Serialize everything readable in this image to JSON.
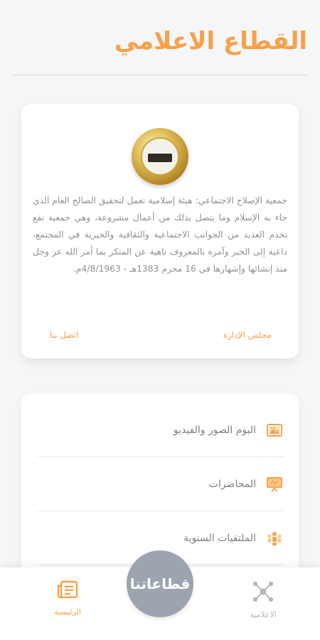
{
  "header": {
    "title": "القطاع الاعلامي"
  },
  "about": {
    "text": "جمعية الإصلاح الاجتماعي: هيئة إسلامية تعمل لتحقيق الصالح العام الذي جاء به الإسلام وما يتصل بذلك من أعمال مشروعة، وهي جمعية نفع تخدم العديد من الجوانب الاجتماعية والثقافية والخيرية في المجتمع، داعية إلى الخير وآمرة بالمعروف ناهية عن المنكر بما أمر الله عز وجل منذ إنشائها وإشهارها في 16 محرم 1383هـ - 4/8/1963م.",
    "board_link": "مجلس الإدارة",
    "contact_link": "اتصل بنا"
  },
  "menu": {
    "items": [
      {
        "label": "البوم الصور والفيديو",
        "icon": "photo-album-icon"
      },
      {
        "label": "المحاضرات",
        "icon": "presentation-board-icon"
      },
      {
        "label": "الملتقيات السنوية",
        "icon": "group-people-icon"
      }
    ]
  },
  "bottom_nav": {
    "home_label": "الرئيسية",
    "center_label": "قطاعاتنا",
    "media_label": "الاعلامية"
  },
  "colors": {
    "accent": "#f7a14a",
    "center_button": "#9ca4b0",
    "muted_text": "#8f9194"
  }
}
